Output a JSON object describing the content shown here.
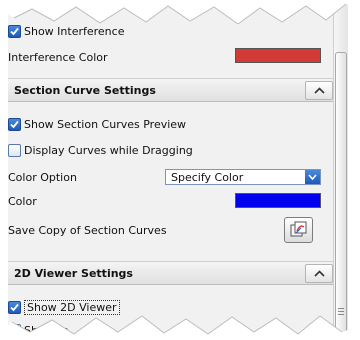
{
  "interference": {
    "show_label": "Show Interference",
    "show_checked": true,
    "color_label": "Interference Color",
    "color": "#d13a35"
  },
  "section_curve": {
    "header": "Section Curve Settings",
    "show_preview_label": "Show Section Curves Preview",
    "show_preview_checked": true,
    "display_dragging_label": "Display Curves while Dragging",
    "display_dragging_checked": false,
    "color_option_label": "Color Option",
    "color_option_value": "Specify Color",
    "color_label": "Color",
    "color": "#0000ee",
    "save_copy_label": "Save Copy of Section Curves"
  },
  "viewer_2d": {
    "header": "2D Viewer Settings",
    "show_label": "Show 2D Viewer",
    "show_checked": true,
    "partial_label": "Sh  ap   in"
  },
  "colors": {
    "panel_bg": "#f1f1f1",
    "checkbox_blue": "#1e5ab8",
    "interference_red": "#d13a35",
    "section_blue": "#0000ee"
  }
}
